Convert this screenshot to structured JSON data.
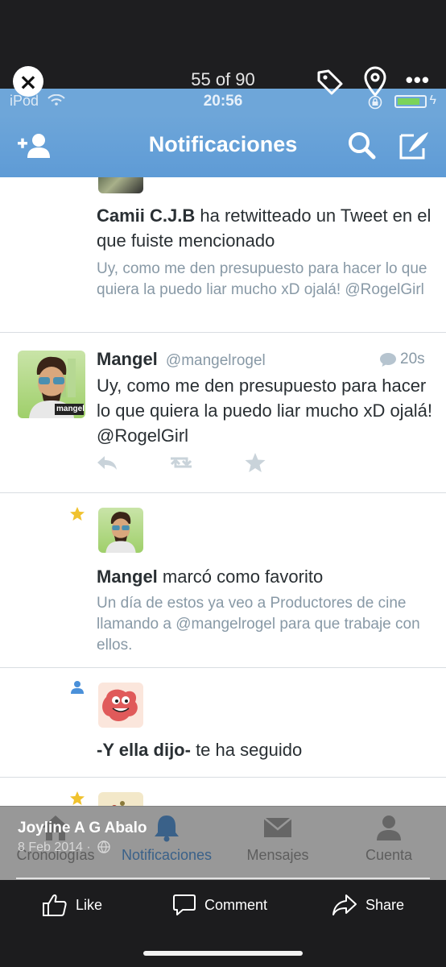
{
  "viewer": {
    "close_icon": "close-icon",
    "counter": "55 of 90",
    "tag_icon": "tag-icon",
    "location_icon": "location-pin-icon",
    "more": "•••"
  },
  "status_bar": {
    "carrier": "iPod",
    "time": "20:56",
    "battery_level": 0.85
  },
  "header": {
    "title": "Notificaciones",
    "add_user_icon": "add-user-icon",
    "search_icon": "search-icon",
    "compose_icon": "compose-icon"
  },
  "notifications": [
    {
      "actor": "Camii C.J.B",
      "action": " ha retwitteado un Tweet en el que fuiste mencionado",
      "quote": "Uy, como me den presupuesto para hacer lo que quiera la puedo liar mucho xD ojalá! @RogelGirl"
    },
    {
      "name": "Mangel",
      "handle": "@mangelrogel",
      "time": "20s",
      "text": "Uy, como me den presupuesto para hacer lo que quiera la puedo liar mucho xD ojalá! @RogelGirl",
      "avatar_label": "mangel"
    },
    {
      "actor": "Mangel",
      "action": " marcó como favorito",
      "quote": "Un día de estos ya veo a Productores de cine llamando a @mangelrogel para que trabaje con ellos."
    },
    {
      "actor": "-Y ella dijo-",
      "action": " te ha seguido"
    }
  ],
  "tabs": [
    {
      "label": "Cronologías",
      "icon": "home-icon"
    },
    {
      "label": "Notificaciones",
      "icon": "bell-icon"
    },
    {
      "label": "Mensajes",
      "icon": "envelope-icon"
    },
    {
      "label": "Cuenta",
      "icon": "person-icon"
    }
  ],
  "photo_post": {
    "poster": "Joyline A G Abalo",
    "date": "8 Feb 2014 ·",
    "globe_icon": "globe-icon"
  },
  "facebook_actions": {
    "like": "Like",
    "comment": "Comment",
    "share": "Share"
  },
  "colors": {
    "twitter_header": "#5e9bd6",
    "star": "#f0c22e",
    "follow_icon": "#4a90d9",
    "active_tab": "#4a90d9"
  }
}
